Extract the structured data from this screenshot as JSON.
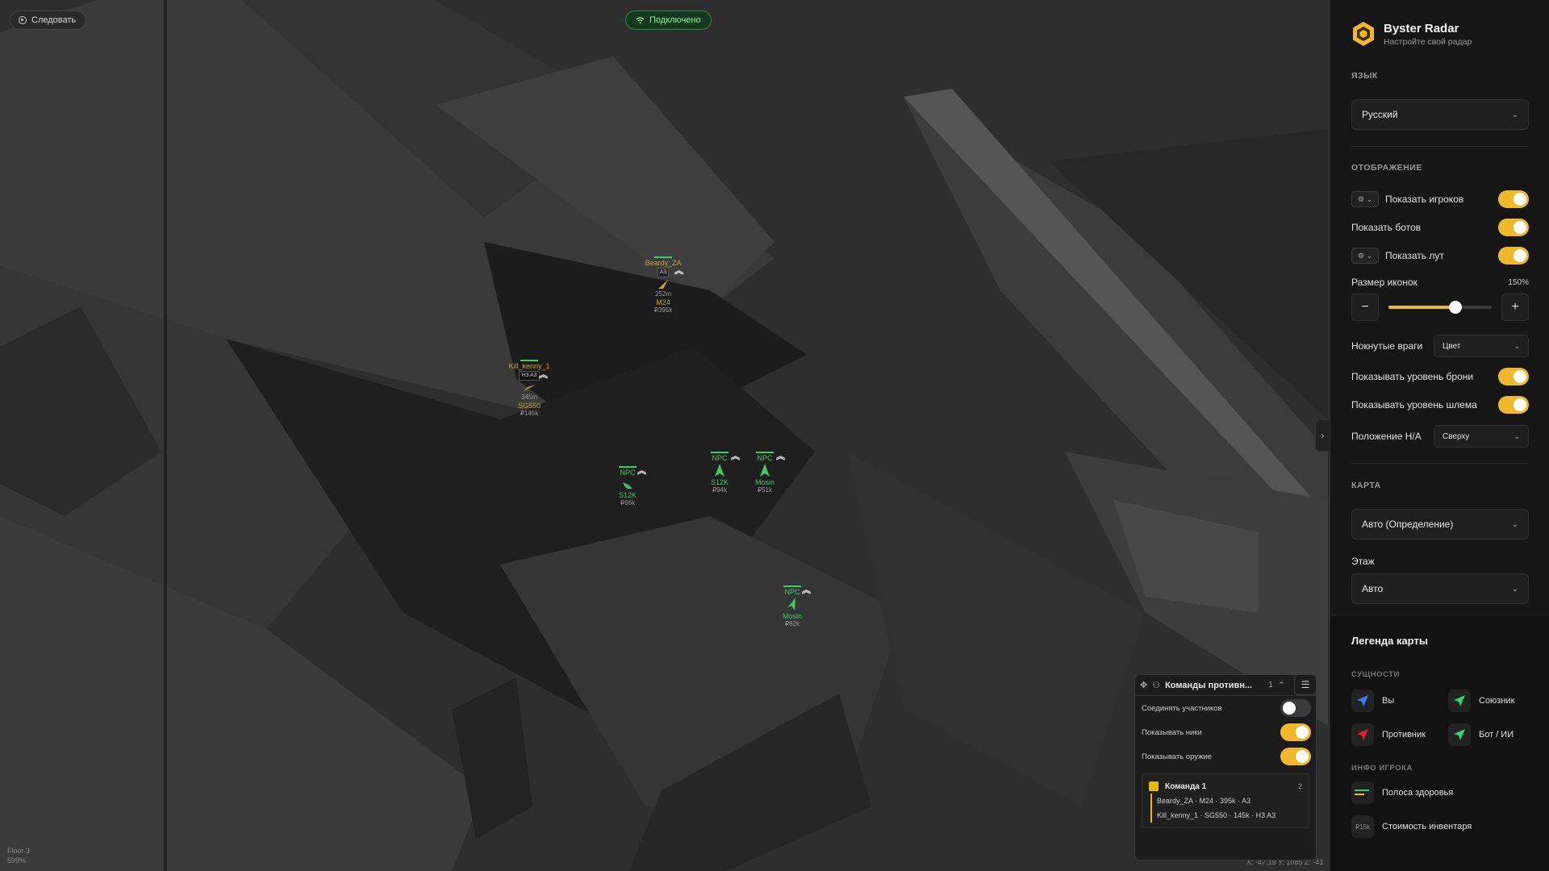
{
  "map": {
    "follow_label": "Следовать",
    "connection_label": "Подключено",
    "floor_label": "Floor 3",
    "zoom_label": "599%",
    "coords_label": "X: -47.19  Y: 1085  Z: -41",
    "entities": [
      {
        "name": "Beardy_ZA",
        "tag": "A3",
        "distance": "252m",
        "weapon": "M24",
        "value": "₽395k",
        "color": "yellow"
      },
      {
        "name": "Kill_kenny_1",
        "tag": "H3 A3",
        "distance": "345m",
        "weapon": "SG550",
        "value": "₽145k",
        "color": "yellow"
      },
      {
        "name": "NPC",
        "weapon": "S12K",
        "value": "₽66k",
        "color": "green"
      },
      {
        "name": "NPC",
        "weapon": "S12K",
        "value": "₽94k",
        "color": "green"
      },
      {
        "name": "NPC",
        "weapon": "Mosin",
        "value": "₽51k",
        "color": "green"
      },
      {
        "name": "NPC",
        "weapon": "Mosin",
        "value": "₽82k",
        "color": "green"
      }
    ]
  },
  "teams_panel": {
    "title": "Команды противн...",
    "count": "1",
    "connect_members": "Соединять участников",
    "show_nicknames": "Показывать ники",
    "show_weapons": "Показывать оружие",
    "team": {
      "name": "Команда 1",
      "count": "2",
      "players": [
        "Beardy_ZA · M24 · 395k · A3",
        "Kill_kenny_1 · SG550 · 145k · H3 A3"
      ]
    }
  },
  "sidebar": {
    "brand_title": "Byster Radar",
    "brand_subtitle": "Настройте свой радар",
    "language_section": "ЯЗЫК",
    "language_value": "Русский",
    "display_section": "ОТОБРАЖЕНИЕ",
    "show_players": "Показать игроков",
    "show_bots": "Показать ботов",
    "show_loot": "Показать лут",
    "icon_size_label": "Размер иконок",
    "icon_size_value": "150%",
    "icon_size_fraction": 0.65,
    "knocked_label": "Нокнутые враги",
    "knocked_value": "Цвет",
    "armor_label": "Показывать уровень брони",
    "helmet_label": "Показывать уровень шлема",
    "ha_position_label": "Положение H/A",
    "ha_position_value": "Сверху",
    "map_section": "КАРТА",
    "map_value": "Авто (Определение)",
    "floor_label": "Этаж",
    "floor_value": "Авто",
    "legend_title": "Легенда карты",
    "entities_section": "СУЩНОСТИ",
    "legend_you": "Вы",
    "legend_ally": "Союзник",
    "legend_enemy": "Противник",
    "legend_bot": "Бот / ИИ",
    "player_info_section": "ИНФО ИГРОКА",
    "legend_health": "Полоса здоровья",
    "legend_value": "Стоимость инвентаря",
    "legend_value_sample": "₽15k"
  },
  "colors": {
    "accent": "#f2b82c",
    "you": "#3b7cff",
    "ally": "#36d26a",
    "enemy": "#e0202a",
    "bot": "#36d26a"
  }
}
